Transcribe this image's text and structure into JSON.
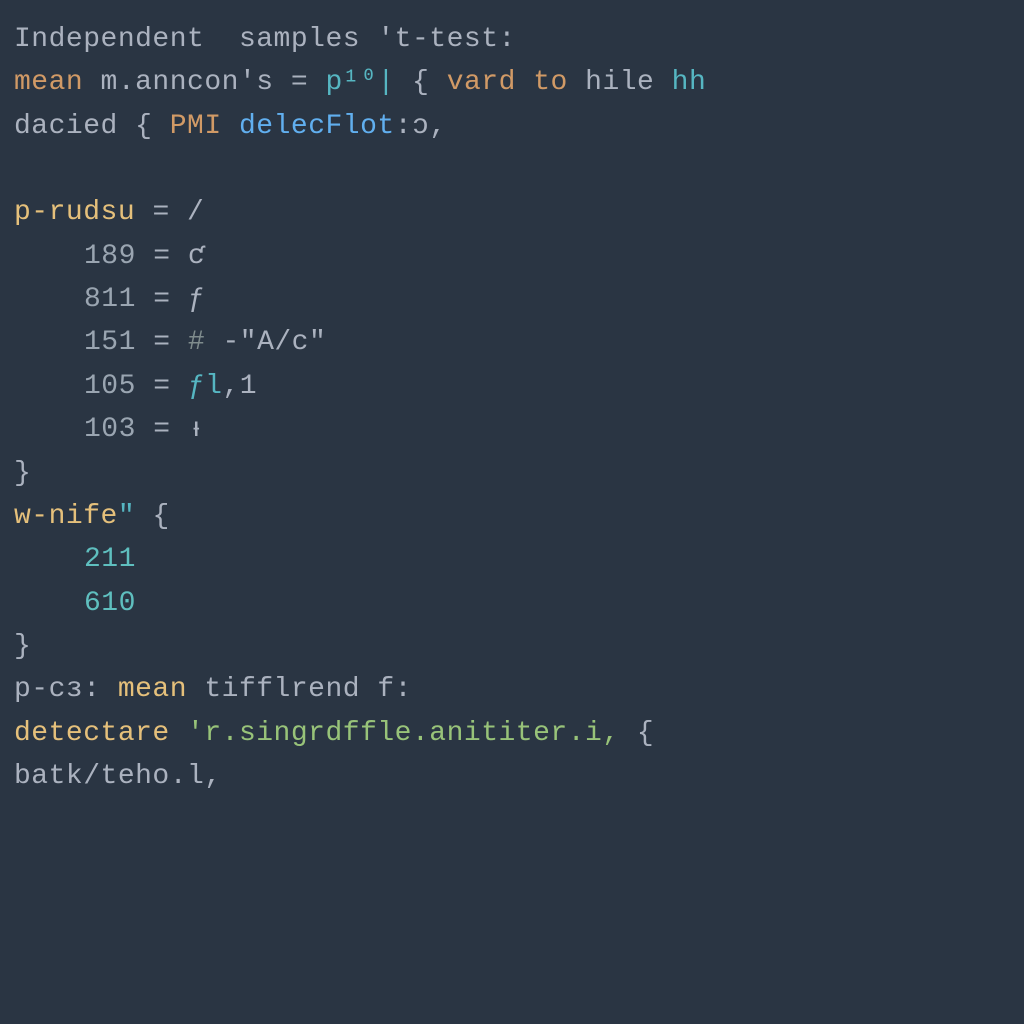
{
  "colors": {
    "bg": "#2a3543",
    "default": "#c9d1d9",
    "yellow": "#e5c07b",
    "orange": "#d19a66",
    "blue": "#61afef",
    "cyan": "#56b6c2",
    "gray": "#abb2bf",
    "green": "#98c379",
    "numgray": "#9aa5b1",
    "comment": "#7f8c8d",
    "teal": "#5fbfbf"
  },
  "line1": {
    "t1": "Independent",
    "t2": "  samples ",
    "t3": "'t-test:"
  },
  "line2": {
    "t1": "mean",
    "t2": " m.anncon's ",
    "t3": "=",
    "t4": " ",
    "t5": "p¹⁰|",
    "t6": " ",
    "t7": "{",
    "t8": " ",
    "t9": "vard",
    "t10": " ",
    "t11": "to",
    "t12": " ",
    "t13": "hile",
    "t14": " ",
    "t15": "hh"
  },
  "line3": {
    "t1": "dacied ",
    "t2": "{",
    "t3": " ",
    "t4": "PMI",
    "t5": " ",
    "t6": "delecFlot",
    "t7": ":ɔ,"
  },
  "line5": {
    "t1": "p-rudsu",
    "t2": " ",
    "t3": "=",
    "t4": " /"
  },
  "line6": {
    "t1": "189",
    "t2": " = ",
    "t3": "ƈ"
  },
  "line7": {
    "t1": "811",
    "t2": " = ",
    "t3": "ƒ"
  },
  "line8": {
    "t1": "151",
    "t2": " = ",
    "t3": "#",
    "t4": " -",
    "t5": "\"A/c\""
  },
  "line9": {
    "t1": "105",
    "t2": " = ",
    "t3": "ƒl",
    "t4": ",",
    "t5": "1"
  },
  "line10": {
    "t1": "103",
    "t2": " = ",
    "t3": "ᵻ"
  },
  "line11": {
    "t1": "}"
  },
  "line12": {
    "t1": "w-nife",
    "t2": "\"",
    "t3": " {"
  },
  "line13": {
    "t1": "211"
  },
  "line14": {
    "t1": "610"
  },
  "line15": {
    "t1": "}"
  },
  "line16": {
    "t1": "p-cɜ: ",
    "t2": "mean",
    "t3": " tifflrend f:"
  },
  "line17": {
    "t1": "detectare",
    "t2": " ",
    "t3": "'r.singrdffle.anititer.i,",
    "t4": " {"
  },
  "line18": {
    "t1": "batk",
    "t2": "/teho.l,"
  }
}
